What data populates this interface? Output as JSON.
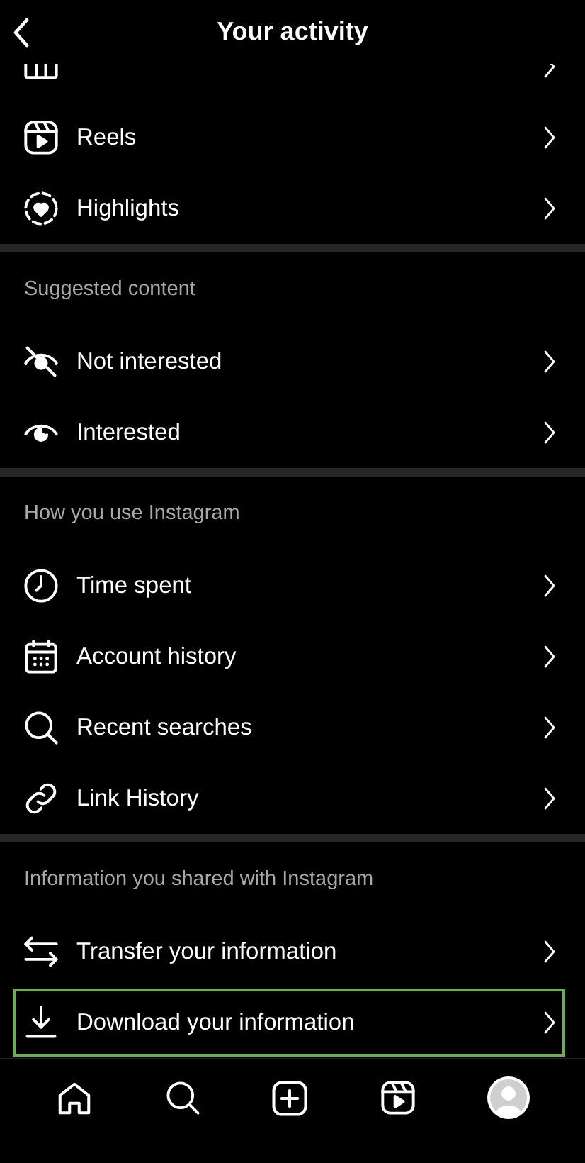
{
  "header": {
    "title": "Your activity"
  },
  "sections": [
    {
      "items": [
        {
          "kind": "grid",
          "highlighted": false
        },
        {
          "label": "Reels",
          "kind": "reels",
          "highlighted": false
        },
        {
          "label": "Highlights",
          "kind": "highlights",
          "highlighted": false
        }
      ]
    },
    {
      "title": "Suggested content",
      "items": [
        {
          "label": "Not interested",
          "kind": "eye-off",
          "highlighted": false
        },
        {
          "label": "Interested",
          "kind": "eye",
          "highlighted": false
        }
      ]
    },
    {
      "title": "How you use Instagram",
      "items": [
        {
          "label": "Time spent",
          "kind": "clock",
          "highlighted": false
        },
        {
          "label": "Account history",
          "kind": "calendar",
          "highlighted": false
        },
        {
          "label": "Recent searches",
          "kind": "search",
          "highlighted": false
        },
        {
          "label": "Link History",
          "kind": "link",
          "highlighted": false
        }
      ]
    },
    {
      "title": "Information you shared with Instagram",
      "items": [
        {
          "label": "Transfer your information",
          "kind": "transfer",
          "highlighted": false
        },
        {
          "label": "Download your information",
          "kind": "download",
          "highlighted": true
        }
      ]
    }
  ],
  "nav": [
    {
      "kind": "home"
    },
    {
      "kind": "search"
    },
    {
      "kind": "create"
    },
    {
      "kind": "reels"
    },
    {
      "kind": "profile"
    }
  ]
}
